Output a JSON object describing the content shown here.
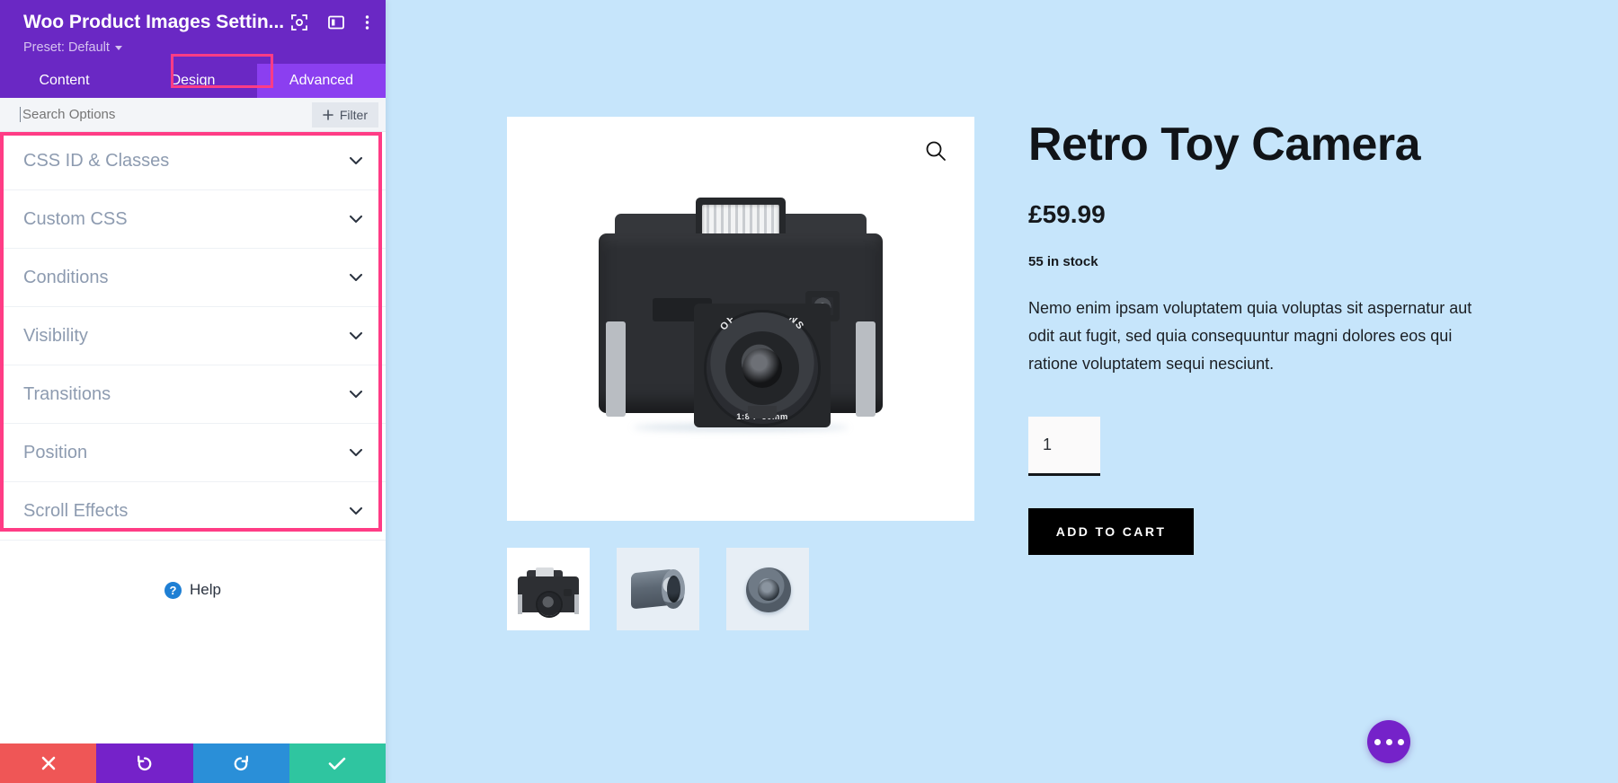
{
  "sidebar": {
    "title": "Woo Product Images Settin...",
    "preset_label": "Preset: Default",
    "header_icons": [
      {
        "name": "focus-frame-icon"
      },
      {
        "name": "layout-panel-icon"
      },
      {
        "name": "more-vertical-icon"
      }
    ],
    "tabs": [
      {
        "label": "Content",
        "active": false
      },
      {
        "label": "Design",
        "active": false
      },
      {
        "label": "Advanced",
        "active": true
      }
    ],
    "search": {
      "placeholder": "Search Options",
      "value": ""
    },
    "filter_button": {
      "label": "Filter",
      "icon": "plus-icon"
    },
    "accordion_items": [
      {
        "label": "CSS ID & Classes"
      },
      {
        "label": "Custom CSS"
      },
      {
        "label": "Conditions"
      },
      {
        "label": "Visibility"
      },
      {
        "label": "Transitions"
      },
      {
        "label": "Position"
      },
      {
        "label": "Scroll Effects"
      }
    ],
    "help": {
      "label": "Help",
      "icon": "question-circle-icon"
    },
    "footer_buttons": [
      {
        "name": "cancel-button",
        "icon": "close-icon",
        "color": "#ef5656"
      },
      {
        "name": "undo-button",
        "icon": "undo-icon",
        "color": "#7522c9"
      },
      {
        "name": "redo-button",
        "icon": "redo-icon",
        "color": "#2a8fd8"
      },
      {
        "name": "save-button",
        "icon": "check-icon",
        "color": "#2fc5a0"
      }
    ],
    "highlight_color": "#ff3c85",
    "brand_color": "#6a28c4"
  },
  "product": {
    "title": "Retro Toy Camera",
    "price": "£59.99",
    "stock": "55 in stock",
    "description": "Nemo enim ipsam voluptatem quia voluptas sit aspernatur aut odit aut fugit, sed quia consequuntur magni dolores eos qui ratione voluptatem sequi nesciunt.",
    "quantity": "1",
    "add_to_cart_label": "ADD TO CART",
    "zoom_icon": "magnifier-icon",
    "lens_text_top": "OPTICAL   LENS",
    "lens_text_bottom": "1:8    f=60mm",
    "thumbnails": [
      {
        "name": "thumbnail-camera",
        "active": true
      },
      {
        "name": "thumbnail-lens-side",
        "active": false
      },
      {
        "name": "thumbnail-lens-front",
        "active": false
      }
    ],
    "canvas_bg": "#c6e5fb"
  },
  "fab": {
    "name": "more-options-fab",
    "icon": "ellipsis-icon",
    "color": "#7522c9"
  }
}
